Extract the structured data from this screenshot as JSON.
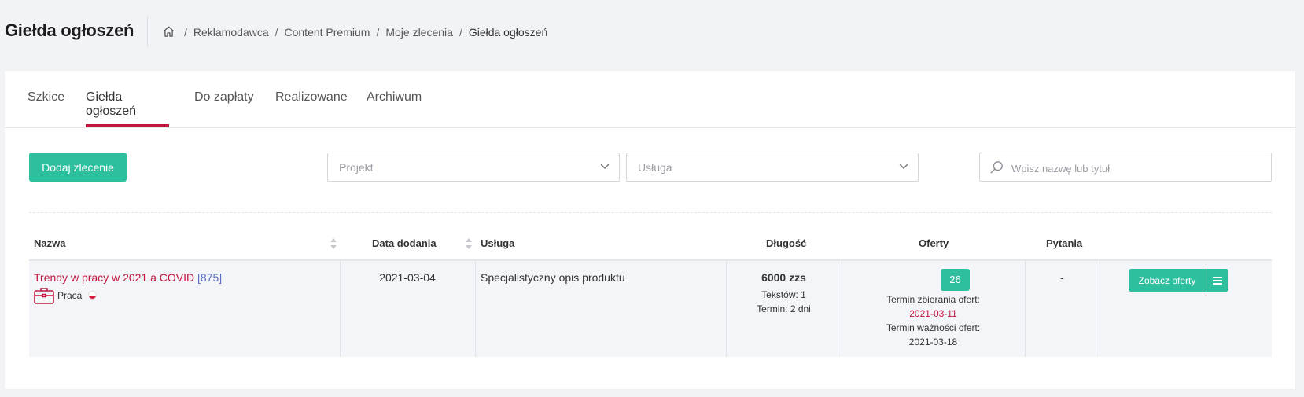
{
  "header": {
    "title": "Giełda ogłoszeń",
    "breadcrumb": [
      "Reklamodawca",
      "Content Premium",
      "Moje zlecenia",
      "Giełda ogłoszeń"
    ]
  },
  "tabs": [
    {
      "label": "Szkice",
      "active": false
    },
    {
      "label": "Giełda ogłoszeń",
      "active": true
    },
    {
      "label": "Do zapłaty",
      "active": false
    },
    {
      "label": "Realizowane",
      "active": false
    },
    {
      "label": "Archiwum",
      "active": false
    }
  ],
  "toolbar": {
    "add_label": "Dodaj zlecenie",
    "project_placeholder": "Projekt",
    "service_placeholder": "Usługa",
    "search_placeholder": "Wpisz nazwę lub tytuł"
  },
  "table": {
    "columns": [
      "Nazwa",
      "Data dodania",
      "Usługa",
      "Długość",
      "Oferty",
      "Pytania"
    ],
    "rows": [
      {
        "title": "Trendy w pracy w 2021 a COVID",
        "id": "[875]",
        "category": "Praca",
        "date": "2021-03-04",
        "service": "Specjalistyczny opis produktu",
        "length": "6000 zzs",
        "texts_label": "Tekstów:",
        "texts_value": "1",
        "term_label": "Termin:",
        "term_value": "2 dni",
        "offers_count": "26",
        "collect_label": "Termin zbierania ofert:",
        "collect_date": "2021-03-11",
        "valid_label": "Termin ważności ofert:",
        "valid_date": "2021-03-18",
        "questions": "-",
        "view_label": "Zobacz oferty"
      }
    ]
  },
  "colors": {
    "accent": "#2ebf9f",
    "brand_red": "#c0163f",
    "id_blue": "#5a6fc4"
  }
}
